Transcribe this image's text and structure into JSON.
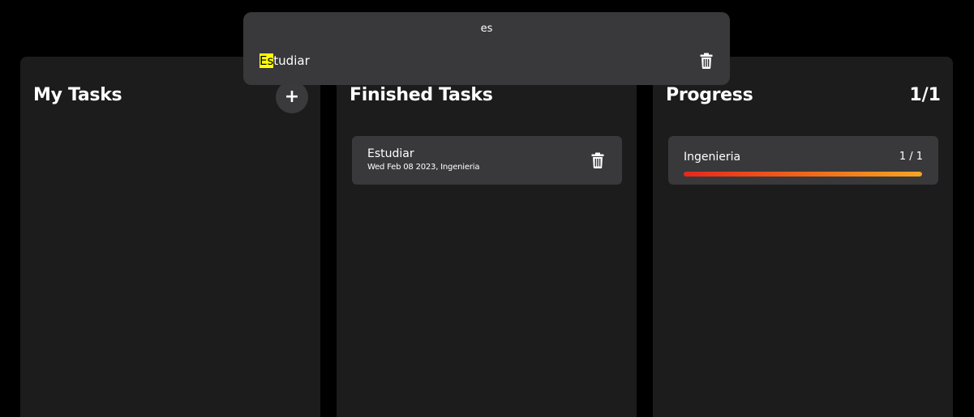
{
  "search": {
    "query": "es",
    "result": {
      "highlight": "Es",
      "rest": "tudiar"
    },
    "highlight_color": "#ffff00"
  },
  "columns": {
    "my_tasks": {
      "title": "My Tasks",
      "add_label": "+"
    },
    "finished": {
      "title": "Finished Tasks",
      "tasks": [
        {
          "name": "Estudiar",
          "meta": "Wed Feb 08 2023, Ingenieria"
        }
      ]
    },
    "progress": {
      "title": "Progress",
      "count": "1/1",
      "items": [
        {
          "name": "Ingenieria",
          "count": "1 / 1",
          "fraction": 1.0
        }
      ]
    }
  },
  "colors": {
    "background": "#000000",
    "column_bg": "#1c1c1c",
    "card_bg": "#39393b",
    "progress_gradient_start": "#e8261c",
    "progress_gradient_end": "#f5a623"
  }
}
